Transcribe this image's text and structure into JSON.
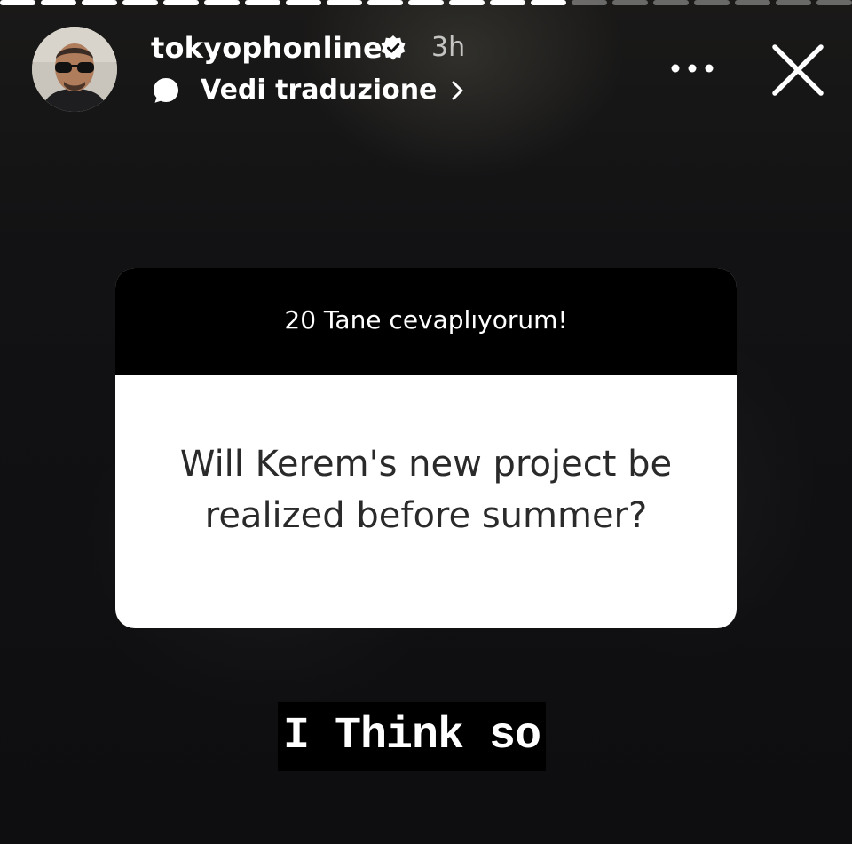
{
  "story": {
    "progress": {
      "segments_total": 21,
      "segments_viewed": 14
    },
    "author": {
      "username": "tokyophonline",
      "verified": true,
      "time_ago": "3h",
      "avatar_icon": "avatar"
    },
    "translate": {
      "label": "Vedi traduzione",
      "icon": "chat-bubble-icon"
    },
    "actions": {
      "more_icon": "more-horizontal-icon",
      "close_icon": "close-icon"
    },
    "question_sticker": {
      "title": "20 Tane cevaplıyorum!",
      "question": "Will Kerem's new project be realized before summer?"
    },
    "answer_text": "I Think so"
  },
  "colors": {
    "background": "#0e0e10",
    "sticker_header": "#000000",
    "sticker_body": "#ffffff",
    "question_text": "#2a2a2a",
    "text_primary": "#ffffff"
  }
}
